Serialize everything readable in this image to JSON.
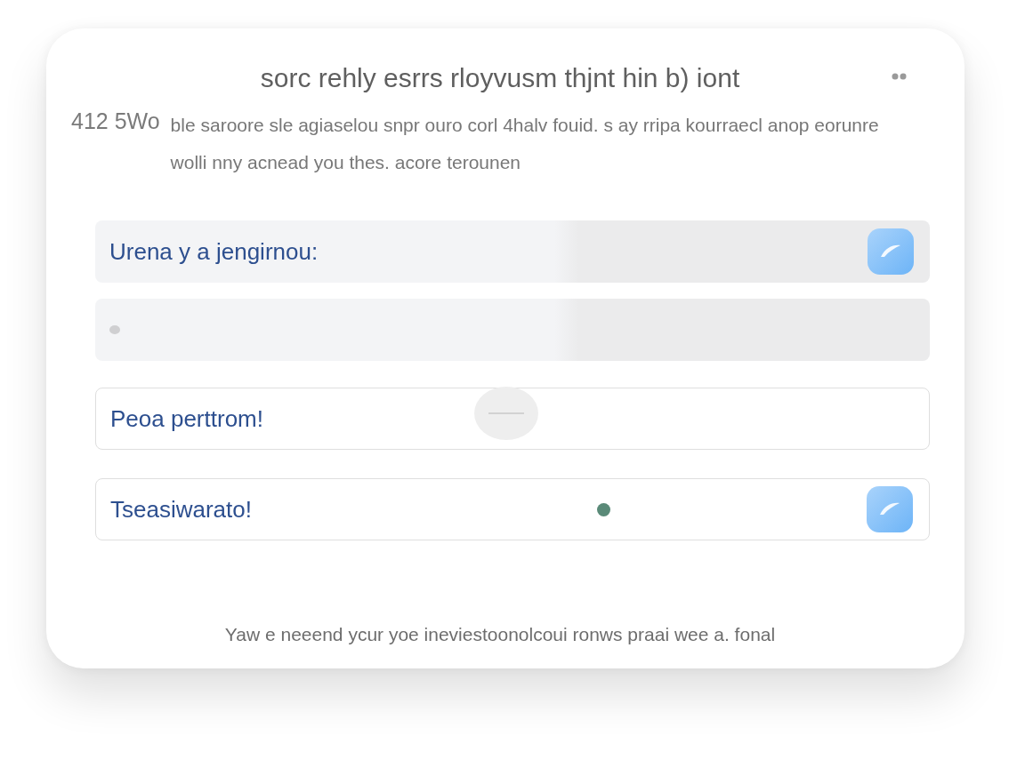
{
  "dialog": {
    "title": "sorc rehly esrrs rloyvusm thjnt hin b) iont",
    "counter": "412 5Wo",
    "description": "ble saroore sle agiaselou snpr ouro corl 4halv fouid. s ay rripa kourraecl anop eorunre wolli nny acnead you thes. acore terounen"
  },
  "rows": [
    {
      "kind": "filled",
      "label": "Urena y a jengirnou:",
      "button": true
    },
    {
      "kind": "filled",
      "dot": true
    },
    {
      "kind": "outlined",
      "label": "Peoa perttrom!",
      "toggle": true
    },
    {
      "kind": "outlined",
      "label": "Tseasiwarato!",
      "color": "#5a8a78",
      "button": true
    }
  ],
  "footer": "Yaw e neeend ycur yoe ineviestoonolcoui ronws praai wee a. fonal"
}
